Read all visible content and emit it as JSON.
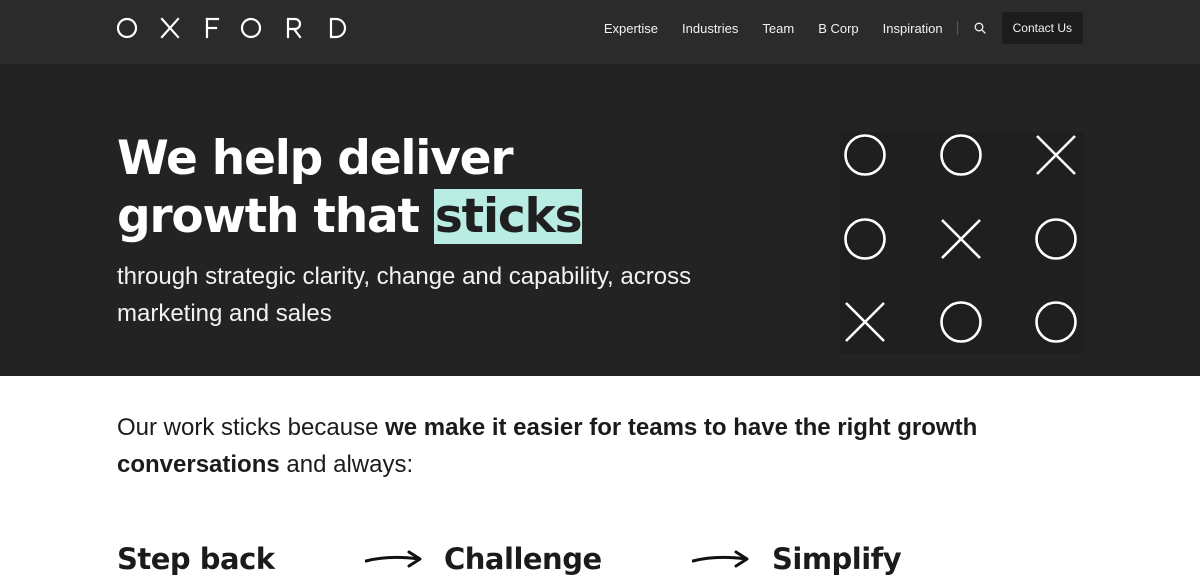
{
  "brand": {
    "logo_text": "OXFORD"
  },
  "nav": {
    "items": [
      "Expertise",
      "Industries",
      "Team",
      "B Corp",
      "Inspiration"
    ],
    "search_icon": "search-icon",
    "contact_label": "Contact Us"
  },
  "hero": {
    "title_line1": "We help deliver",
    "title_line2_prefix": "growth that ",
    "title_highlight": "sticks",
    "subtitle": "through strategic clarity, change and capability, across marketing and sales",
    "highlight_color": "#b9ece2",
    "grid_symbols": [
      "O",
      "O",
      "X",
      "O",
      "X",
      "O",
      "X",
      "O",
      "O"
    ]
  },
  "intro": {
    "prefix": "Our work sticks because ",
    "bold": "we make it easier for teams to have the right growth conversations",
    "suffix": " and always:"
  },
  "steps": [
    "Step back",
    "Challenge",
    "Simplify"
  ],
  "colors": {
    "header_bg": "#2b2b2b",
    "hero_bg": "#232323",
    "text_dark": "#1b1b1b"
  }
}
